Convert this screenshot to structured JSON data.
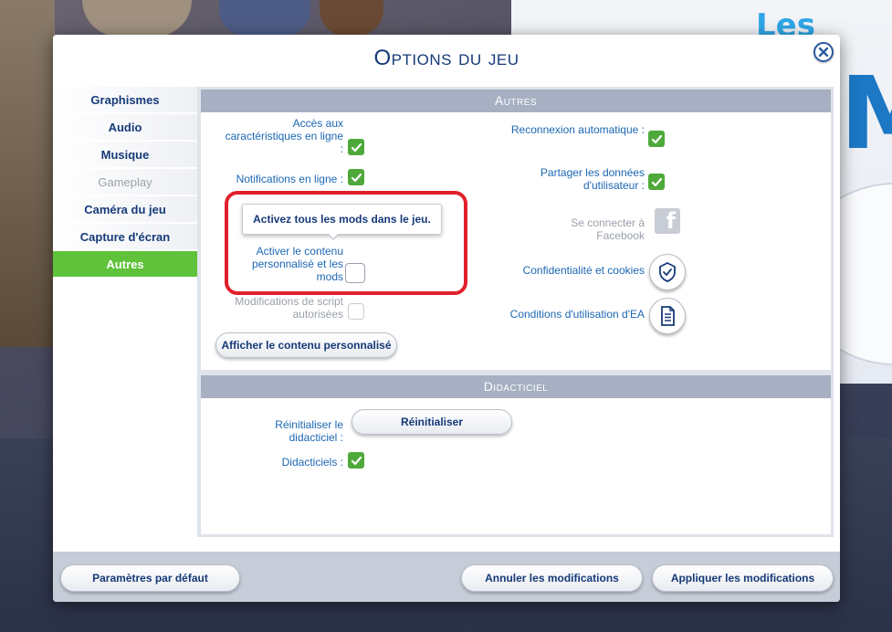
{
  "dialog": {
    "title": "Options du jeu"
  },
  "sidebar": {
    "items": [
      {
        "label": "Graphismes",
        "state": "normal"
      },
      {
        "label": "Audio",
        "state": "normal"
      },
      {
        "label": "Musique",
        "state": "normal"
      },
      {
        "label": "Gameplay",
        "state": "disabled"
      },
      {
        "label": "Caméra du jeu",
        "state": "normal"
      },
      {
        "label": "Capture d'écran",
        "state": "normal"
      },
      {
        "label": "Autres",
        "state": "active"
      }
    ]
  },
  "autres": {
    "header": "Autres",
    "left": {
      "online_features": {
        "label": "Accès aux caractéristiques en ligne :",
        "checked": true
      },
      "online_notifications": {
        "label": "Notifications en ligne :",
        "checked": true
      },
      "custom_content": {
        "label": "Activer le contenu personnalisé et les mods",
        "checked": false
      },
      "script_mods": {
        "label": "Modifications de script autorisées",
        "checked": false
      },
      "show_custom_button": "Afficher le contenu personnalisé"
    },
    "tooltip": "Activez tous les mods dans le jeu.",
    "right": {
      "auto_reconnect": {
        "label": "Reconnexion automatique :",
        "checked": true
      },
      "share_data": {
        "label": "Partager les données d'utilisateur :",
        "checked": true
      },
      "facebook": {
        "label": "Se connecter à Facebook",
        "icon": "facebook-icon"
      },
      "privacy": {
        "label": "Confidentialité et cookies",
        "icon": "shield-check-icon"
      },
      "terms": {
        "label": "Conditions d'utilisation d'EA",
        "icon": "document-icon"
      }
    }
  },
  "tutorial": {
    "header": "Didacticiel",
    "reset_label": "Réinitialiser le didacticiel :",
    "reset_button": "Réinitialiser",
    "tutorials": {
      "label": "Didacticiels :",
      "checked": true
    }
  },
  "footer": {
    "defaults_button": "Paramètres par défaut",
    "cancel_button": "Annuler les modifications",
    "apply_button": "Appliquer les modifications"
  },
  "colors": {
    "accent_green": "#5fc23a",
    "title_blue": "#163a78",
    "label_blue": "#1c67b3",
    "highlight_red": "#e0202a"
  }
}
